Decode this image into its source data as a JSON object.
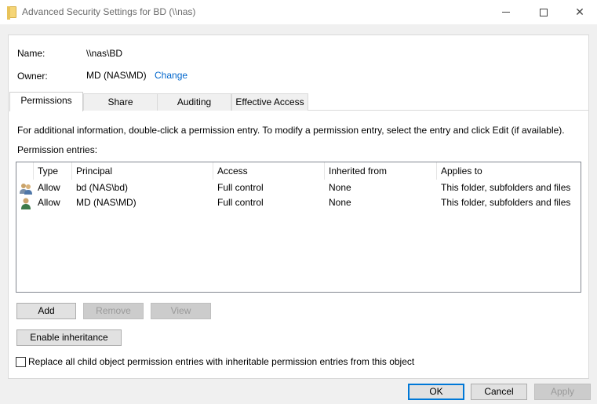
{
  "window": {
    "title": "Advanced Security Settings for BD (\\\\nas)"
  },
  "info": {
    "name_label": "Name:",
    "name_value": "\\\\nas\\BD",
    "owner_label": "Owner:",
    "owner_value": "MD (NAS\\MD)",
    "change_link": "Change"
  },
  "tabs": [
    {
      "label": "Permissions",
      "active": true
    },
    {
      "label": "Share",
      "active": false
    },
    {
      "label": "Auditing",
      "active": false
    },
    {
      "label": "Effective Access",
      "active": false
    }
  ],
  "permissions": {
    "help_text": "For additional information, double-click a permission entry. To modify a permission entry, select the entry and click Edit (if available).",
    "entries_label": "Permission entries:",
    "columns": [
      "Type",
      "Principal",
      "Access",
      "Inherited from",
      "Applies to"
    ],
    "rows": [
      {
        "icon": "group-icon",
        "type": "Allow",
        "principal": "bd (NAS\\bd)",
        "access": "Full control",
        "inherited": "None",
        "applies": "This folder, subfolders and files"
      },
      {
        "icon": "user-icon",
        "type": "Allow",
        "principal": "MD (NAS\\MD)",
        "access": "Full control",
        "inherited": "None",
        "applies": "This folder, subfolders and files"
      }
    ],
    "buttons": {
      "add": "Add",
      "remove": "Remove",
      "view": "View",
      "enable_inheritance": "Enable inheritance"
    },
    "replace_checkbox_label": "Replace all child object permission entries with inheritable permission entries from this object",
    "replace_checked": false
  },
  "footer": {
    "ok": "OK",
    "cancel": "Cancel",
    "apply": "Apply"
  },
  "colors": {
    "link": "#0066cc",
    "focus_border": "#0078d7"
  }
}
